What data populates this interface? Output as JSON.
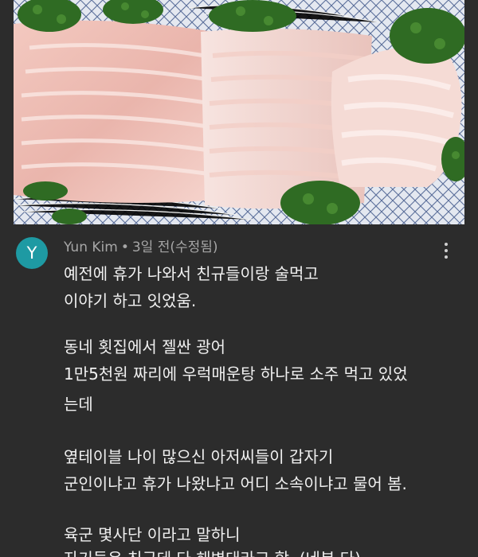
{
  "photo": {
    "description_icon": "sashimi-platter-image"
  },
  "comment": {
    "avatar_letter": "Y",
    "avatar_color": "#1e9aa3",
    "author": "Yun Kim",
    "separator": "•",
    "time": "3일 전(수정됨)",
    "lines": [
      "예전에 휴가 나와서 친규들이랑 술먹고",
      "이야기 하고 잇었움.",
      "",
      " 동네 횟집에서 젤싼 광어",
      "1만5천원 짜리에 우럭매운탕 하나로 소주 먹고 있었",
      "는데",
      "",
      "옆테이블 나이 많으신 아저씨들이 갑자기",
      "군인이냐고 휴가 나왔냐고 어디 소속이냐고 물어 봄.",
      "",
      "육군 몇사단 이라고 말하니",
      "자기들은 친구데 다 해병대라고 함. (네분 다)"
    ]
  },
  "colors": {
    "background": "#2c2c2c",
    "text": "#f0f0f0",
    "meta_text": "#a6a6a6"
  }
}
